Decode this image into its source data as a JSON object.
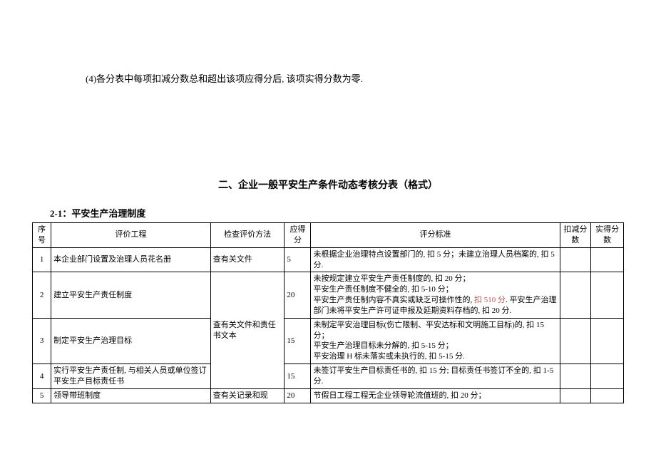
{
  "note_text": "(4)各分表中每项扣减分数总和超出该项应得分后, 该项实得分数为零.",
  "main_title": "二、企业一般平安生产条件动态考核分表（格式）",
  "section_label": "2-1：平安生产治理制度",
  "headers": {
    "idx": "序号",
    "item": "评价工程",
    "method": "检查评价方法",
    "due": "应得分",
    "criteria": "评分标准",
    "deduct": "扣减分数",
    "actual": "实得分数"
  },
  "rows": [
    {
      "idx": "1",
      "item": "本企业部门设置及治理人员花名册",
      "method": "查有关文件",
      "due": "5",
      "criteria": "未根据企业治理特点设置部门的, 扣 5 分；未建立治理人员档案的, 扣 5 分.",
      "deduct": "",
      "actual": ""
    },
    {
      "idx": "2",
      "item": "建立平安生产责任制度",
      "method": "",
      "due": "20",
      "criteria_parts": {
        "before": "未按规定建立平安生产责任制度的, 扣 20 分；\n平安生产责任制度不健全的, 扣 5-10 分；\n平安生产责任制内容不真实或缺乏可操作性的, ",
        "red": "扣 510 分",
        "after": ". 平安生产治理部门未将平安生产许可证申报及延期资料存档的, 扣 20 分."
      },
      "deduct": "",
      "actual": ""
    },
    {
      "idx": "3",
      "item": "制定平安生产治理目标",
      "method": "查有关文件和责任书文本",
      "due": "15",
      "criteria": "未制定平安治理目标(伤亡限制、平安达标和文明施工目标)的, 扣 15 分；\n平安生产治理目标未分解的, 扣 5-15 分；\n平安治理 H 标未落实或未执行的, 扣 5-15 分.",
      "deduct": "",
      "actual": ""
    },
    {
      "idx": "4",
      "item": "实行平安生产责任制, 与相关人员或单位签订平安生产目标责任书",
      "method": "",
      "due": "15",
      "criteria": "未签订平安生产目标责任书的, 扣 15 分; 目标责任书签订不全的, 扣 1-5 分.",
      "deduct": "",
      "actual": ""
    },
    {
      "idx": "5",
      "item": "领导带班制度",
      "method": "查有关记录和现",
      "due": "20",
      "criteria": "节假日工程工程无企业领导轮流值班的, 扣 20 分；",
      "deduct": "",
      "actual": ""
    }
  ]
}
